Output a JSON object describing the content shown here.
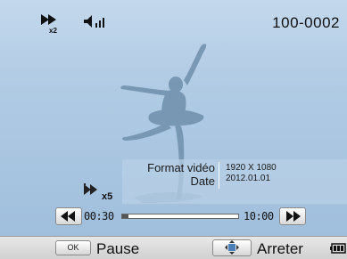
{
  "status": {
    "play_speed_icon": "fast-forward-x2-icon",
    "volume_icon": "volume-icon",
    "file_number": "100-0002"
  },
  "info": {
    "format_label": "Format vidéo",
    "date_label": "Date",
    "format_value": "1920 X 1080",
    "date_value": "2012.01.01"
  },
  "fast_mode": {
    "icon": "fast-motion-icon",
    "label": "x5"
  },
  "playback": {
    "current_time": "00:30",
    "total_time": "10:00",
    "progress_fraction": 0.05
  },
  "controls": {
    "ok_key": "OK",
    "pause_label": "Pause",
    "stop_label": "Arreter",
    "battery_icon": "battery-icon"
  }
}
